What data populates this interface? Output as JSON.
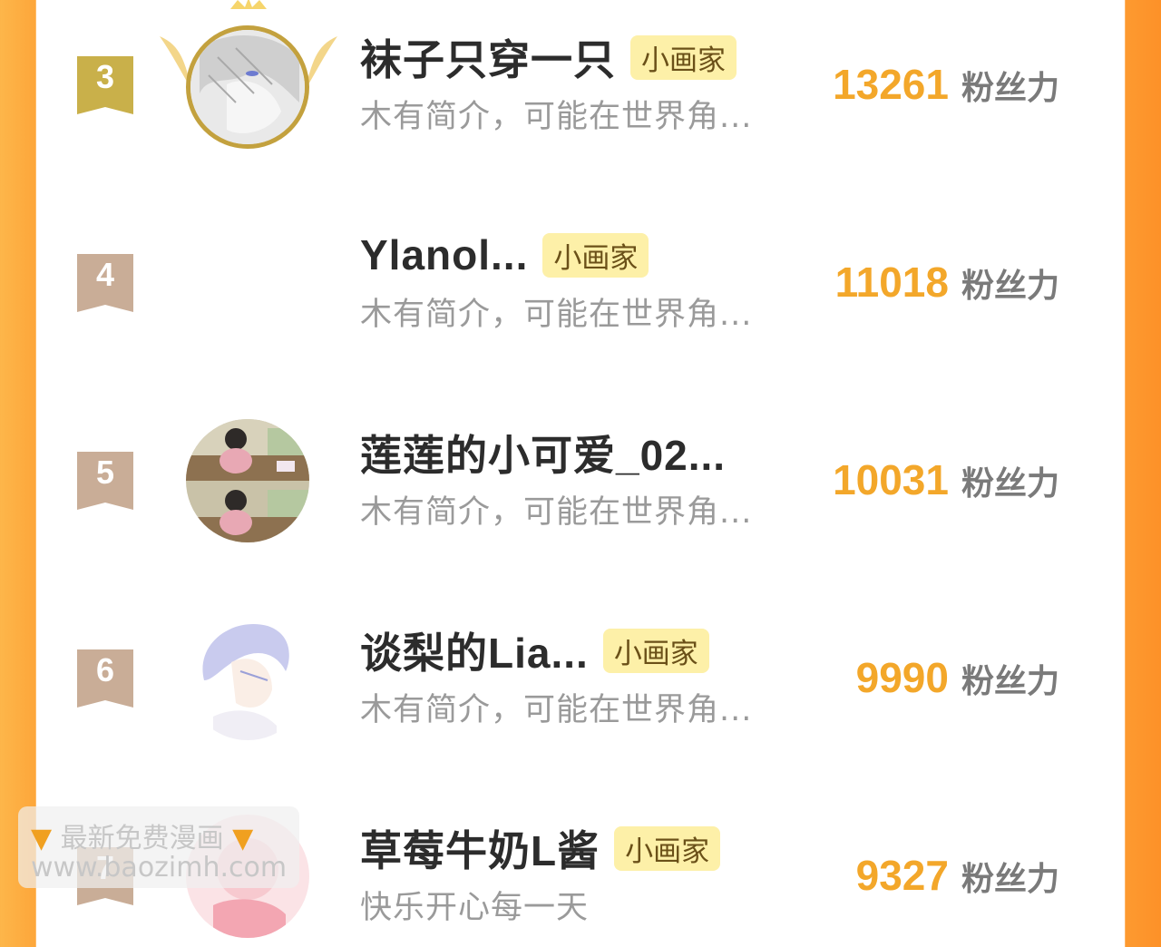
{
  "list": {
    "score_unit": "粉丝力",
    "rows": [
      {
        "rank": "3",
        "name": "袜子只穿一只",
        "tag": "小画家",
        "intro": "木有简介，可能在世界角...",
        "score": "13261"
      },
      {
        "rank": "4",
        "name": "Ylanol...",
        "tag": "小画家",
        "intro": "木有简介，可能在世界角...",
        "score": "11018"
      },
      {
        "rank": "5",
        "name": "莲莲的小可爱_02...",
        "tag": "",
        "intro": "木有简介，可能在世界角...",
        "score": "10031"
      },
      {
        "rank": "6",
        "name": "谈梨的Lia...",
        "tag": "小画家",
        "intro": "木有简介，可能在世界角...",
        "score": "9990"
      },
      {
        "rank": "7",
        "name": "草莓牛奶L酱",
        "tag": "小画家",
        "intro": "快乐开心每一天",
        "score": "9327"
      }
    ]
  },
  "watermark": {
    "line1": "最新免费漫画",
    "line2": "www.baozimh.com",
    "icon": "pointing-down-hand-icon"
  },
  "colors": {
    "accent": "#f3a72a",
    "side_bar": "#fda63a",
    "tag_bg": "#fdf0a8",
    "rank3_badge": "#cfb24c",
    "rank_badge": "#c9ad97"
  }
}
